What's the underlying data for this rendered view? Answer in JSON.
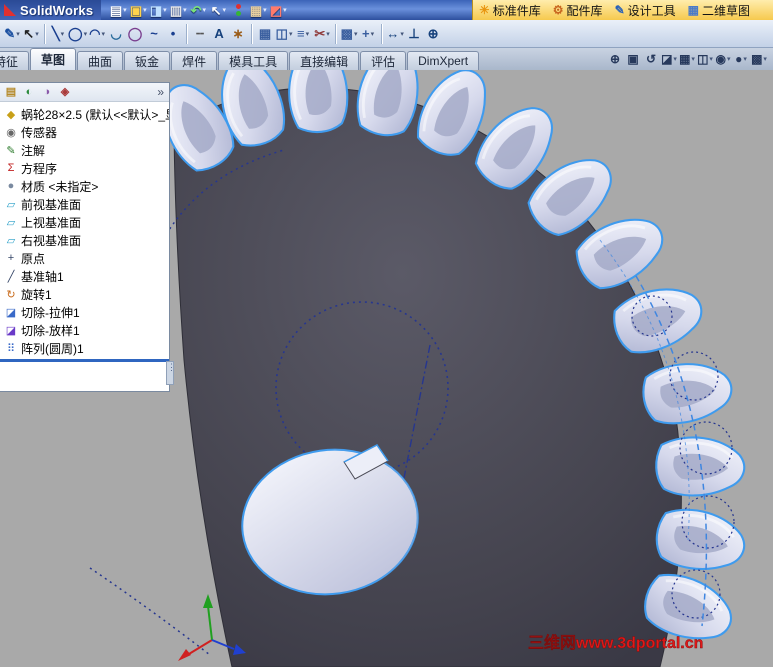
{
  "titlebar": {
    "app_name": "SolidWorks"
  },
  "toolbar_main": {
    "icons": [
      {
        "name": "new-document-icon",
        "glyph": "▤",
        "color": "#ffffff",
        "caret": true
      },
      {
        "name": "open-folder-icon",
        "glyph": "▣",
        "color": "#ffd34d",
        "caret": true
      },
      {
        "name": "save-icon",
        "glyph": "◨",
        "color": "#bfe0ff",
        "caret": true
      },
      {
        "name": "print-icon",
        "glyph": "▥",
        "color": "#e8e8e8",
        "caret": true
      },
      {
        "name": "undo-icon",
        "glyph": "↶",
        "color": "#7be37b",
        "caret": true
      },
      {
        "name": "select-cursor-icon",
        "glyph": "↖",
        "color": "#ffffff",
        "caret": true
      },
      {
        "name": "rebuild-stoplight-icon",
        "type": "stoplight",
        "caret": false
      },
      {
        "name": "options-board-icon",
        "glyph": "▦",
        "color": "#e8cfa0",
        "caret": true
      },
      {
        "name": "help-icon",
        "glyph": "◩",
        "color": "#ff7b6b",
        "caret": true
      }
    ]
  },
  "addin_bar": {
    "items": [
      {
        "label": "标准件库",
        "icon": "standard-parts-icon",
        "glyph": "☀",
        "color": "#e8950f"
      },
      {
        "label": "配件库",
        "icon": "fittings-library-icon",
        "glyph": "⚙",
        "color": "#c8661f"
      },
      {
        "label": "设计工具",
        "icon": "design-tools-icon",
        "glyph": "✎",
        "color": "#2a62b8"
      },
      {
        "label": "二维草图",
        "icon": "sketch-2d-icon",
        "glyph": "▦",
        "color": "#4a7ac8"
      }
    ]
  },
  "toolbar_sketch": {
    "icons": [
      {
        "name": "sketch-tool-icon",
        "glyph": "✎",
        "color": "#1a4fa0",
        "caret": true
      },
      {
        "name": "select-arrow-icon",
        "glyph": "↖",
        "color": "#222222",
        "caret": true
      },
      {
        "sep": true
      },
      {
        "name": "line-tool-icon",
        "glyph": "╲",
        "color": "#1a3f8f",
        "caret": true
      },
      {
        "name": "circle-tool-icon",
        "glyph": "◯",
        "color": "#1a3f8f",
        "caret": true
      },
      {
        "name": "arc-tool-icon",
        "glyph": "◠",
        "color": "#1a3f8f",
        "caret": true
      },
      {
        "name": "tangent-arc-icon",
        "glyph": "◡",
        "color": "#276a9a",
        "caret": false
      },
      {
        "name": "ellipse-tool-icon",
        "glyph": "◯",
        "color": "#7a3f8f",
        "caret": false
      },
      {
        "name": "spline-tool-icon",
        "glyph": "~",
        "color": "#1a3f8f",
        "caret": false
      },
      {
        "name": "point-tool-icon",
        "glyph": "•",
        "color": "#1a3f8f",
        "caret": false
      },
      {
        "sep": true
      },
      {
        "name": "centerline-tool-icon",
        "glyph": "╌",
        "color": "#555555",
        "caret": false
      },
      {
        "name": "text-tool-icon",
        "glyph": "A",
        "color": "#16417c",
        "caret": false
      },
      {
        "name": "equation-tool-icon",
        "glyph": "∗",
        "color": "#9a5b16",
        "caret": false
      },
      {
        "sep": true
      },
      {
        "name": "grid-tool-icon",
        "glyph": "▦",
        "color": "#3a5f9f",
        "caret": false
      },
      {
        "name": "mirror-entities-icon",
        "glyph": "◫",
        "color": "#3a5f9f",
        "caret": true
      },
      {
        "name": "offset-entities-icon",
        "glyph": "≡",
        "color": "#3a5f9f",
        "caret": true
      },
      {
        "name": "trim-entities-icon",
        "glyph": "✂",
        "color": "#8f3a3a",
        "caret": true
      },
      {
        "sep": true
      },
      {
        "name": "linear-pattern-icon",
        "glyph": "▩",
        "color": "#3a5f9f",
        "caret": true
      },
      {
        "name": "move-entities-icon",
        "glyph": "+",
        "color": "#3a5f9f",
        "caret": true
      },
      {
        "sep": true
      },
      {
        "name": "smart-dimension-icon",
        "glyph": "↔",
        "color": "#16417c",
        "caret": true
      },
      {
        "name": "add-relation-icon",
        "glyph": "⊥",
        "color": "#16417c",
        "caret": false
      },
      {
        "name": "snap-icon",
        "glyph": "⊕",
        "color": "#16417c",
        "caret": false
      }
    ]
  },
  "command_tabs": {
    "tabs": [
      {
        "label": "特征",
        "active": false
      },
      {
        "label": "草图",
        "active": true
      },
      {
        "label": "曲面",
        "active": false
      },
      {
        "label": "钣金",
        "active": false
      },
      {
        "label": "焊件",
        "active": false
      },
      {
        "label": "模具工具",
        "active": false
      },
      {
        "label": "直接编辑",
        "active": false
      },
      {
        "label": "评估",
        "active": false
      },
      {
        "label": "DimXpert",
        "active": false
      }
    ]
  },
  "view_tools": {
    "icons": [
      {
        "name": "zoom-fit-icon",
        "glyph": "⊕",
        "caret": false
      },
      {
        "name": "zoom-area-icon",
        "glyph": "▣",
        "caret": false
      },
      {
        "name": "previous-view-icon",
        "glyph": "↺",
        "caret": false
      },
      {
        "name": "section-view-icon",
        "glyph": "◪",
        "caret": true
      },
      {
        "name": "view-orientation-icon",
        "glyph": "▦",
        "caret": true
      },
      {
        "name": "display-style-icon",
        "glyph": "◫",
        "caret": true
      },
      {
        "name": "hide-show-items-icon",
        "glyph": "◉",
        "caret": true
      },
      {
        "name": "edit-appearance-icon",
        "glyph": "●",
        "caret": true
      },
      {
        "name": "apply-scene-icon",
        "glyph": "▩",
        "caret": true
      }
    ]
  },
  "feature_tree": {
    "header_icons": [
      {
        "name": "featuremanager-tab-icon",
        "glyph": "▤",
        "color": "#b58a2a"
      },
      {
        "name": "propertymanager-tab-icon",
        "glyph": "◐",
        "color": "#2a8a3a"
      },
      {
        "name": "configurationmanager-tab-icon",
        "glyph": "◑",
        "color": "#8a5aaa"
      },
      {
        "name": "dimxpertmanager-tab-icon",
        "glyph": "◈",
        "color": "#aa3a3a"
      }
    ],
    "overflow_label": "»",
    "items": [
      {
        "name": "tree-item-part",
        "icon": "part-icon",
        "glyph": "◆",
        "color": "#c8a018",
        "label": "蜗轮28×2.5 (默认<<默认>_显"
      },
      {
        "name": "tree-item-sensors",
        "icon": "sensors-icon",
        "glyph": "◉",
        "color": "#666666",
        "label": "传感器"
      },
      {
        "name": "tree-item-annotations",
        "icon": "annotations-icon",
        "glyph": "✎",
        "color": "#2a7a2a",
        "label": "注解"
      },
      {
        "name": "tree-item-equations",
        "icon": "equations-icon",
        "glyph": "Σ",
        "color": "#c02020",
        "label": "方程序"
      },
      {
        "name": "tree-item-material",
        "icon": "material-icon",
        "glyph": "●",
        "color": "#7a8aa0",
        "label": "材质 <未指定>"
      },
      {
        "name": "tree-item-front-plane",
        "icon": "plane-icon",
        "glyph": "▱",
        "color": "#2aa0c8",
        "label": "前视基准面"
      },
      {
        "name": "tree-item-top-plane",
        "icon": "plane-icon",
        "glyph": "▱",
        "color": "#2aa0c8",
        "label": "上视基准面"
      },
      {
        "name": "tree-item-right-plane",
        "icon": "plane-icon",
        "glyph": "▱",
        "color": "#2aa0c8",
        "label": "右视基准面"
      },
      {
        "name": "tree-item-origin",
        "icon": "origin-icon",
        "glyph": "+",
        "color": "#334466",
        "label": "原点"
      },
      {
        "name": "tree-item-axis1",
        "icon": "axis-icon",
        "glyph": "╱",
        "color": "#334466",
        "label": "基准轴1"
      },
      {
        "name": "tree-item-revolve1",
        "icon": "revolve-icon",
        "glyph": "↻",
        "color": "#c86a1a",
        "label": "旋转1"
      },
      {
        "name": "tree-item-cut-extrude1",
        "icon": "cut-extrude-icon",
        "glyph": "◪",
        "color": "#3a6ac8",
        "label": "切除-拉伸1"
      },
      {
        "name": "tree-item-cut-loft1",
        "icon": "cut-loft-icon",
        "glyph": "◪",
        "color": "#6a3ac8",
        "label": "切除-放样1"
      },
      {
        "name": "tree-item-cirpattern1",
        "icon": "circular-pattern-icon",
        "glyph": "⠿",
        "color": "#3a6ac8",
        "label": "阵列(圆周)1"
      }
    ],
    "rollback_color": "#2f66c0"
  },
  "viewport": {
    "watermark": "三维网www.3dportal.cn",
    "background": "#a9a9a9",
    "body_color": "#43424e",
    "selection_color": "#3f9bee",
    "construction_color": "#26368f"
  }
}
